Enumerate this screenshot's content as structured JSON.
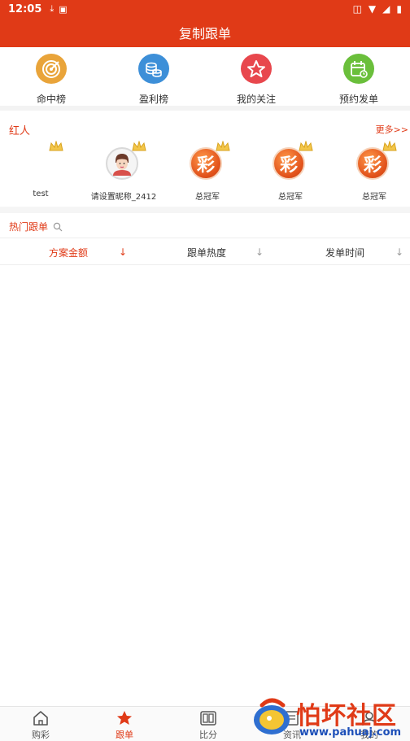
{
  "status_bar": {
    "time": "12:05"
  },
  "header": {
    "title": "复制跟单"
  },
  "quick_nav": [
    {
      "label": "命中榜",
      "icon": "target-icon",
      "color": "#e9a43a"
    },
    {
      "label": "盈利榜",
      "icon": "coins-icon",
      "color": "#3d8fd8"
    },
    {
      "label": "我的关注",
      "icon": "star-icon",
      "color": "#e8474d"
    },
    {
      "label": "预约发单",
      "icon": "calendar-icon",
      "color": "#6abf3b"
    }
  ],
  "featured": {
    "title": "红人",
    "more": "更多>>",
    "users": [
      {
        "name": "test",
        "avatar": "none"
      },
      {
        "name": "请设置昵称_2412",
        "avatar": "person"
      },
      {
        "name": "总冠军",
        "avatar": "cai",
        "avatar_text": "彩"
      },
      {
        "name": "总冠军",
        "avatar": "cai",
        "avatar_text": "彩"
      },
      {
        "name": "总冠军",
        "avatar": "cai",
        "avatar_text": "彩"
      }
    ]
  },
  "hot": {
    "title": "热门跟单",
    "sort_columns": [
      {
        "label": "方案金额",
        "arrow": "↓",
        "active": true
      },
      {
        "label": "跟单热度",
        "arrow": "↓",
        "active": false
      },
      {
        "label": "发单时间",
        "arrow": "↓",
        "active": false
      }
    ]
  },
  "tab_bar": [
    {
      "label": "购彩",
      "icon": "home-icon",
      "active": false
    },
    {
      "label": "跟单",
      "icon": "star-icon",
      "active": true
    },
    {
      "label": "比分",
      "icon": "score-icon",
      "active": false
    },
    {
      "label": "资讯",
      "icon": "news-icon",
      "active": false
    },
    {
      "label": "我的",
      "icon": "user-icon",
      "active": false
    }
  ],
  "watermark": {
    "title": "怕坏社区",
    "url": "www.pahuaj.com"
  },
  "colors": {
    "brand": "#e03a17",
    "text": "#333333"
  }
}
